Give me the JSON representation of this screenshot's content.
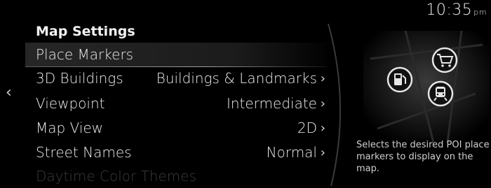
{
  "status": {
    "time": "10:35",
    "ampm": "pm"
  },
  "menu": {
    "title": "Map Settings",
    "items": [
      {
        "label": "Place Markers",
        "value": "",
        "selected": true
      },
      {
        "label": "3D Buildings",
        "value": "Buildings & Landmarks"
      },
      {
        "label": "Viewpoint",
        "value": "Intermediate"
      },
      {
        "label": "Map View",
        "value": "2D"
      },
      {
        "label": "Street Names",
        "value": "Normal"
      },
      {
        "label": "Daytime Color Themes",
        "value": ""
      }
    ]
  },
  "description": "Selects the desired POI place markers to display on the map.",
  "preview": {
    "icons": [
      "fuel-station-icon",
      "shopping-cart-icon",
      "train-station-icon"
    ]
  },
  "nav": {
    "back_glyph": "‹"
  }
}
